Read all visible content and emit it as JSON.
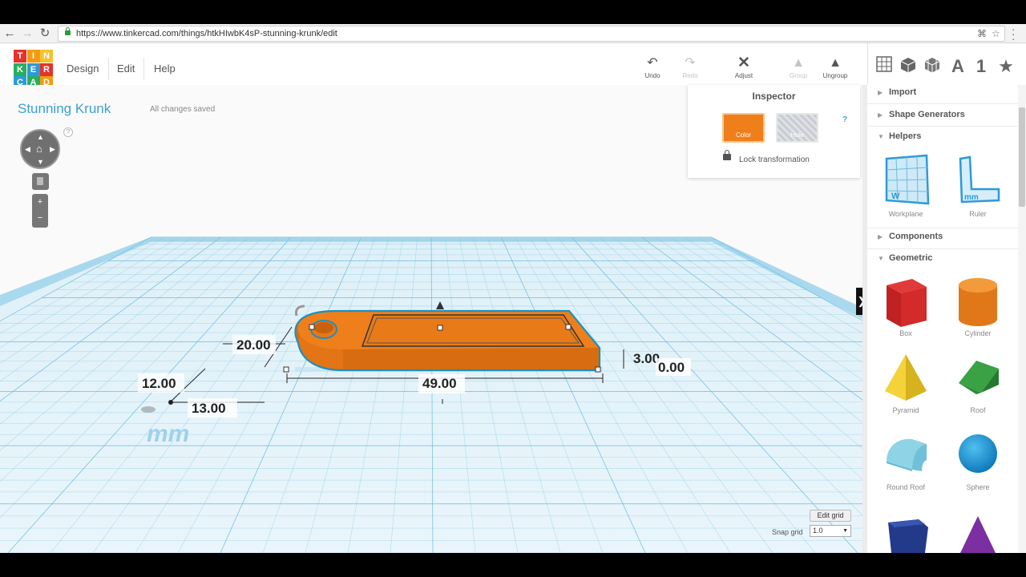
{
  "browser": {
    "url": "https://www.tinkercad.com/things/htkHIwbK4sP-stunning-krunk/edit"
  },
  "logo": {
    "letters": [
      "T",
      "I",
      "N",
      "K",
      "E",
      "R",
      "C",
      "A",
      "D"
    ],
    "colors": [
      "#e5332a",
      "#f39c12",
      "#f6c22e",
      "#27ae60",
      "#2d9ad7",
      "#e5332a",
      "#2d9ad7",
      "#27ae60",
      "#f39c12"
    ]
  },
  "menu": {
    "design": "Design",
    "edit": "Edit",
    "help": "Help"
  },
  "toolbar": {
    "undo": "Undo",
    "redo": "Redo",
    "adjust": "Adjust",
    "group": "Group",
    "ungroup": "Ungroup"
  },
  "view_icons": {
    "text_icon": "A",
    "number_icon": "1",
    "star_icon": "★"
  },
  "design": {
    "title": "Stunning Krunk",
    "save_status": "All changes saved",
    "help_mark": "?"
  },
  "dimensions": {
    "height": "20.00",
    "depth": "12.00",
    "offset": "13.00",
    "width": "49.00",
    "thickness": "3.00",
    "elevation": "0.00",
    "unit": "mm"
  },
  "inspector": {
    "title": "Inspector",
    "color_label": "Color",
    "hole_label": "Hole",
    "help": "?",
    "lock_label": "Lock transformation",
    "color": "#ef7f1a"
  },
  "grid": {
    "edit_label": "Edit grid",
    "snap_label": "Snap grid",
    "snap_value": "1.0"
  },
  "panel": {
    "sections": {
      "import": "Import",
      "shape_generators": "Shape Generators",
      "helpers": "Helpers",
      "components": "Components",
      "geometric": "Geometric"
    },
    "helpers": [
      "Workplane",
      "Ruler"
    ],
    "shapes": [
      "Box",
      "Cylinder",
      "Pyramid",
      "Roof",
      "Round Roof",
      "Sphere"
    ]
  },
  "colors": {
    "accent": "#3aa1cf",
    "shape_orange": "#ef7f1a",
    "grid_line": "#5fb6dc"
  }
}
